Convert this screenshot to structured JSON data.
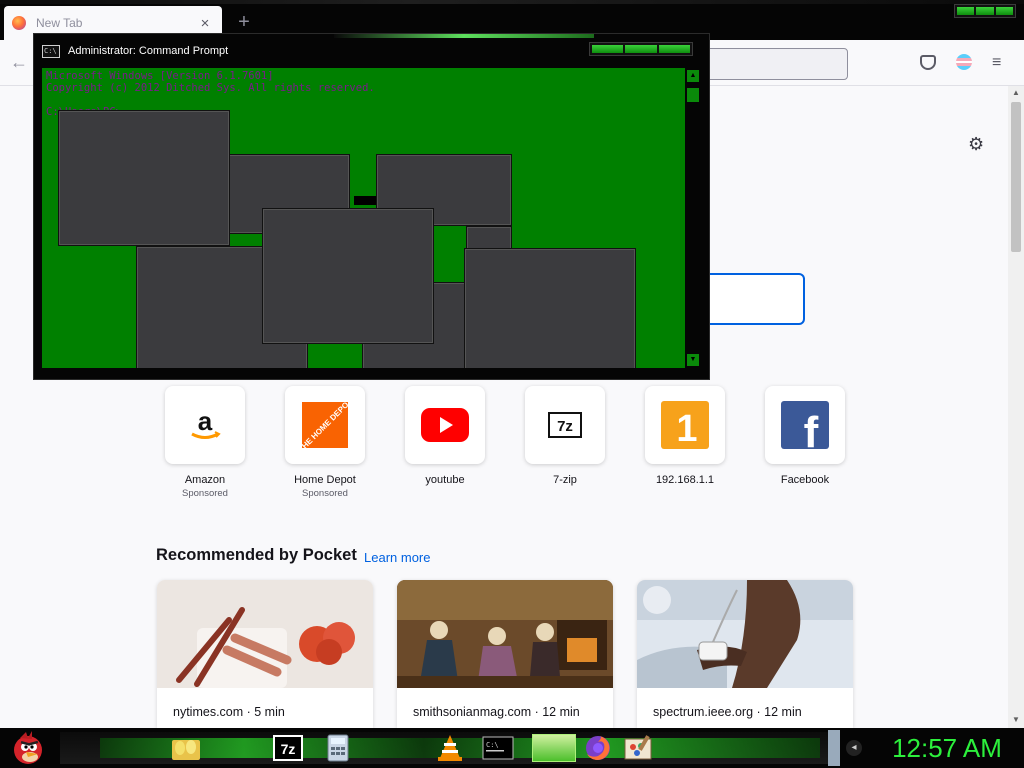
{
  "browser": {
    "tab_title": "New Tab",
    "tab_close": "×",
    "new_tab": "+",
    "back_icon": "arrow-left-icon",
    "menu_glyph": "≡",
    "settings_glyph": "⚙"
  },
  "cmd": {
    "title": "Administrator: Command Prompt",
    "lines": [
      "Microsoft Windows [Version 6.1.7601]",
      "Copyright (c) 2012 Ditched Sys.  All rights reserved.",
      "",
      "C:\\Users\\PC>"
    ]
  },
  "shortcuts": [
    {
      "label": "Amazon",
      "sponsored": "Sponsored"
    },
    {
      "label": "Home Depot",
      "sponsored": "Sponsored"
    },
    {
      "label": "youtube",
      "sponsored": ""
    },
    {
      "label": "7-zip",
      "sponsored": ""
    },
    {
      "label": "192.168.1.1",
      "sponsored": ""
    },
    {
      "label": "Facebook",
      "sponsored": ""
    }
  ],
  "logos": {
    "amazon": "a",
    "homedepot": "THE HOME DEPOT",
    "sevenzip": "7z",
    "router": "1",
    "facebook": "f"
  },
  "pocket": {
    "heading": "Recommended by Pocket",
    "learn_more": "Learn more",
    "cards": [
      {
        "source": "nytimes.com · 5 min"
      },
      {
        "source": "smithsonianmag.com · 12 min"
      },
      {
        "source": "spectrum.ieee.org · 12 min"
      }
    ]
  },
  "taskbar": {
    "clock": "12:57 AM",
    "apps": [
      "angry-birds-start",
      "eggs",
      "7-zip",
      "calculator",
      "vlc",
      "command-prompt",
      "active-window",
      "firefox",
      "paint"
    ]
  },
  "colors": {
    "console_bg": "#008000",
    "accent_green": "#2cf03c",
    "link_blue": "#0061e0"
  }
}
